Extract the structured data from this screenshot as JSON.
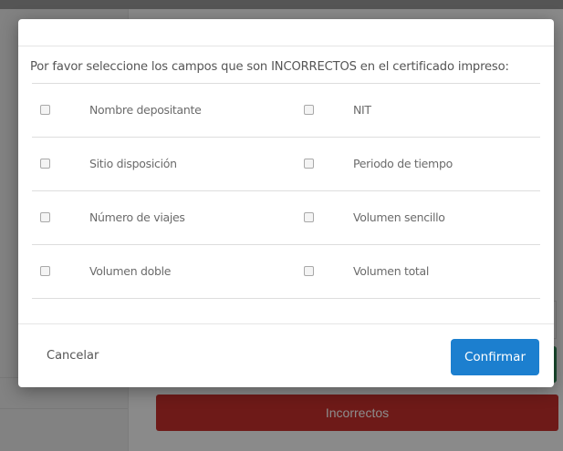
{
  "background": {
    "incorrect_button_label": "Incorrectos"
  },
  "modal": {
    "instruction": "Por favor seleccione los campos que son INCORRECTOS en el certificado impreso:",
    "rows": [
      {
        "left": "Nombre depositante",
        "right": "NIT"
      },
      {
        "left": "Sitio disposición",
        "right": "Periodo de tiempo"
      },
      {
        "left": "Número de viajes",
        "right": "Volumen sencillo"
      },
      {
        "left": "Volumen doble",
        "right": "Volumen total"
      }
    ],
    "cancel_label": "Cancelar",
    "confirm_label": "Confirmar"
  },
  "colors": {
    "confirm": "#1c7fcf",
    "incorrect": "#c9302c"
  }
}
